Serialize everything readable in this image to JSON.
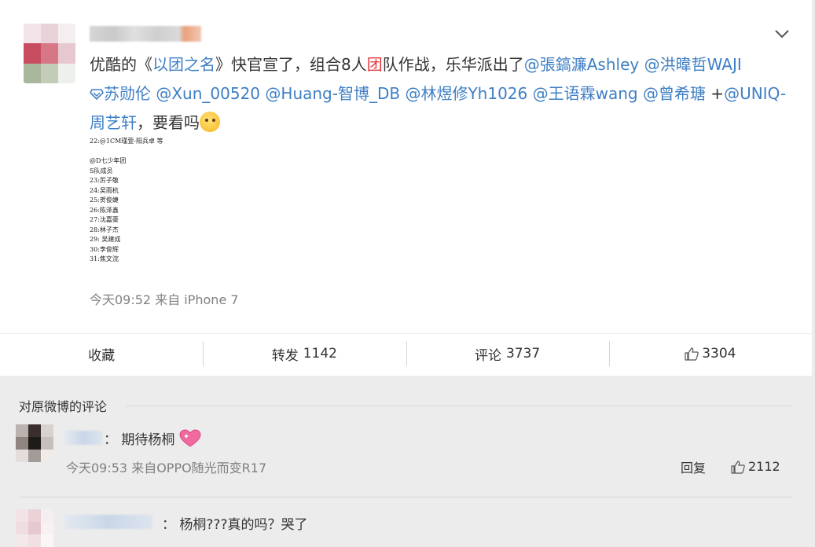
{
  "post": {
    "text_prefix": "优酷的《",
    "text_highlight": "以团之名",
    "text_mid1": "》快官宣了，组合8人",
    "text_highlight2": "团",
    "text_mid2": "队作战，乐华派出了",
    "mentions_line1": [
      "@張鎬濂Ashley",
      "@洪暐哲WAJI"
    ],
    "mentions_line2": [
      "苏勋伦",
      "@Xun_00520",
      "@Huang-智博_DB",
      "@林煜修Yh1026",
      "@王语霖wang",
      "@曾希瑭"
    ],
    "plus": " +",
    "mention_line2_last": "@UNIQ-",
    "mention_line3": "周艺轩",
    "text_suffix": "，要看吗",
    "timestamp": "今天09:52 来自 iPhone 7",
    "image_lines": [
      "22:@1CM瑾萱-阳兵卓 等",
      "",
      "@D七少年团",
      "S队成员",
      "23:厉子敬",
      "24:吴雨杭",
      "25:贺俊婕",
      "26:陈泽鑫",
      "27:沈嘉豪",
      "28:林子杰",
      "29: 吴建成",
      "30:李俊辉",
      "31:焦文浣"
    ]
  },
  "actions": {
    "favorite_label": "收藏",
    "repost_label": "转发",
    "repost_count": "1142",
    "comment_label": "评论",
    "comment_count": "3737",
    "like_count": "3304"
  },
  "comments_section": {
    "title": "对原微博的评论",
    "items": [
      {
        "text": "：  期待杨桐",
        "meta": "今天09:53 来自OPPO随光而变R17",
        "reply_label": "回复",
        "like_count": "2112"
      },
      {
        "text": "：  杨桐???真的吗？哭了"
      }
    ]
  },
  "icons": [
    "chevron-down-icon",
    "vip-diamond-icon",
    "smiling-face-emoji",
    "thumbs-up-icon",
    "sparkling-heart-emoji"
  ],
  "colors": {
    "link": "#3e7fc4",
    "highlight": "#e4393c",
    "meta": "#808080",
    "background": "#ececec"
  }
}
